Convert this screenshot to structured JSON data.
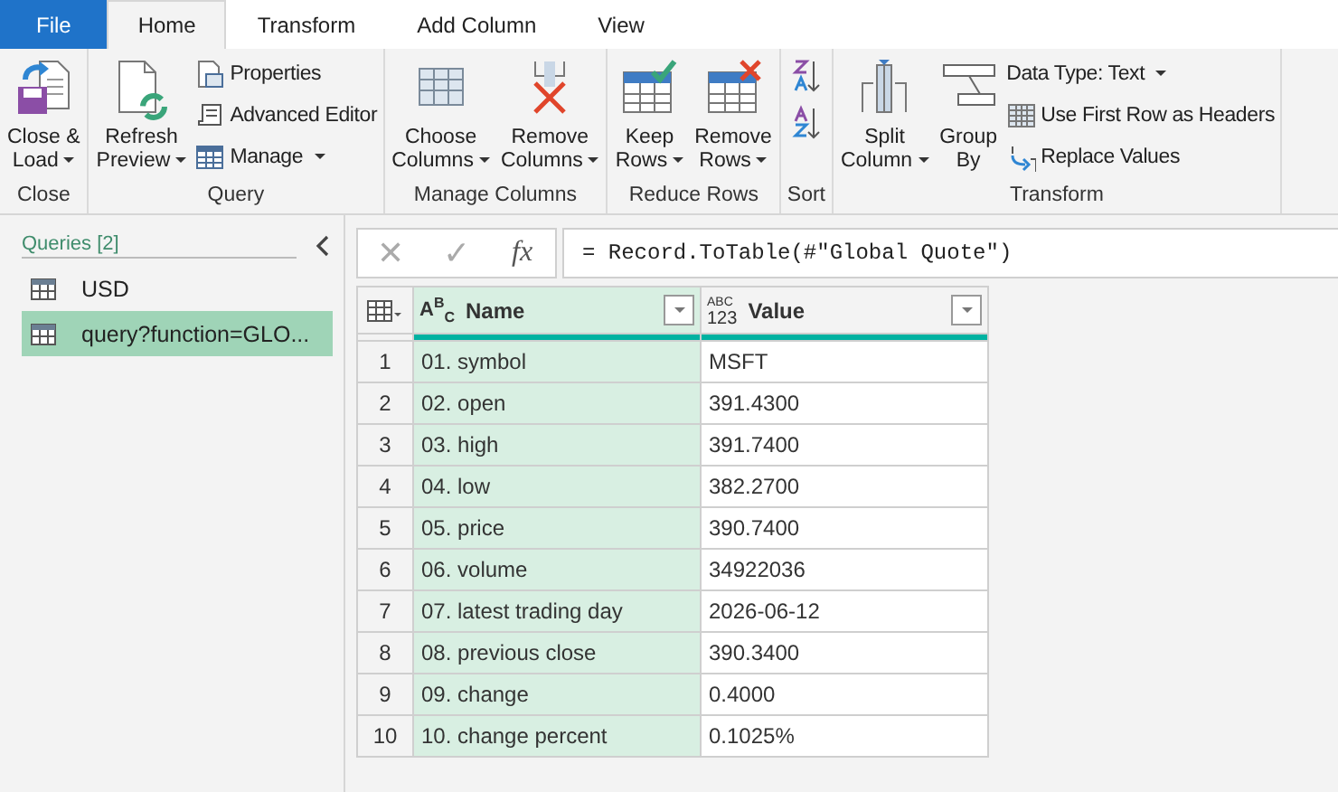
{
  "tabs": [
    {
      "label": "File",
      "kind": "file",
      "selected": false
    },
    {
      "label": "Home",
      "kind": "tab",
      "selected": true
    },
    {
      "label": "Transform",
      "kind": "tab",
      "selected": false
    },
    {
      "label": "Add Column",
      "kind": "tab",
      "selected": false
    },
    {
      "label": "View",
      "kind": "tab",
      "selected": false
    }
  ],
  "ribbon": {
    "groups": [
      {
        "label": "Close",
        "items": [
          {
            "kind": "large",
            "lines": [
              "Close &",
              "Load"
            ],
            "dropdown": true
          }
        ]
      },
      {
        "label": "Query",
        "items": [
          {
            "kind": "large",
            "lines": [
              "Refresh",
              "Preview"
            ],
            "dropdown": true
          },
          {
            "kind": "stack",
            "buttons": [
              {
                "label": "Properties",
                "dropdown": false
              },
              {
                "label": "Advanced Editor",
                "dropdown": false
              },
              {
                "label": "Manage",
                "dropdown": true
              }
            ]
          }
        ]
      },
      {
        "label": "Manage Columns",
        "items": [
          {
            "kind": "large",
            "lines": [
              "Choose",
              "Columns"
            ],
            "dropdown": true
          },
          {
            "kind": "large",
            "lines": [
              "Remove",
              "Columns"
            ],
            "dropdown": true
          }
        ]
      },
      {
        "label": "Reduce Rows",
        "items": [
          {
            "kind": "large",
            "lines": [
              "Keep",
              "Rows"
            ],
            "dropdown": true
          },
          {
            "kind": "large",
            "lines": [
              "Remove",
              "Rows"
            ],
            "dropdown": true
          }
        ]
      },
      {
        "label": "Sort",
        "items": [
          {
            "kind": "sort"
          }
        ]
      },
      {
        "label": "Transform",
        "items": [
          {
            "kind": "large",
            "lines": [
              "Split",
              "Column"
            ],
            "dropdown": true
          },
          {
            "kind": "large",
            "lines": [
              "Group",
              "By"
            ],
            "dropdown": false
          },
          {
            "kind": "stack",
            "buttons": [
              {
                "label": "Data Type: Text",
                "dropdown": true
              },
              {
                "label": "Use First Row as Headers",
                "dropdown": false
              },
              {
                "label": "Replace Values",
                "dropdown": false
              }
            ]
          }
        ]
      }
    ]
  },
  "queries": {
    "title": "Queries [2]",
    "items": [
      {
        "label": "USD",
        "selected": false
      },
      {
        "label": "query?function=GLO...",
        "selected": true
      }
    ]
  },
  "formula_bar": {
    "cancel": "✕",
    "confirm": "✓",
    "fx": "fx",
    "formula": "= Record.ToTable(#\"Global Quote\")"
  },
  "table": {
    "columns": [
      {
        "label": "Name",
        "kind": "text",
        "type_label": "A$^{B}$$_{C}$",
        "selected": true
      },
      {
        "label": "Value",
        "kind": "any",
        "type_lines": [
          "ABC",
          "123"
        ],
        "selected": false
      }
    ],
    "rows": [
      {
        "num": "1",
        "cells": [
          "01. symbol",
          "MSFT"
        ]
      },
      {
        "num": "2",
        "cells": [
          "02. open",
          "391.4300"
        ]
      },
      {
        "num": "3",
        "cells": [
          "03. high",
          "391.7400"
        ]
      },
      {
        "num": "4",
        "cells": [
          "04. low",
          "382.2700"
        ]
      },
      {
        "num": "5",
        "cells": [
          "05. price",
          "390.7400"
        ]
      },
      {
        "num": "6",
        "cells": [
          "06. volume",
          "34922036"
        ]
      },
      {
        "num": "7",
        "cells": [
          "07. latest trading day",
          "2026-06-12"
        ]
      },
      {
        "num": "8",
        "cells": [
          "08. previous close",
          "390.3400"
        ]
      },
      {
        "num": "9",
        "cells": [
          "09. change",
          "0.4000"
        ]
      },
      {
        "num": "10",
        "cells": [
          "10. change percent",
          "0.1025%"
        ]
      }
    ]
  }
}
